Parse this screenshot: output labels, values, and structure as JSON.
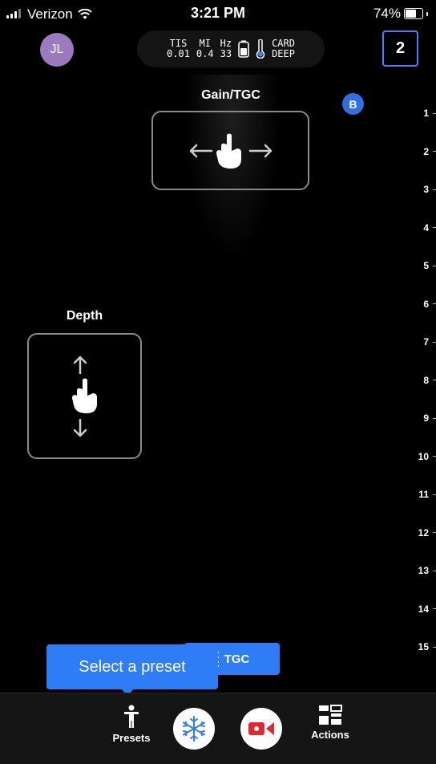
{
  "status_bar": {
    "carrier": "Verizon",
    "time": "3:21 PM",
    "battery": "74%",
    "battery_level": 0.74
  },
  "header": {
    "avatar_initials": "JL",
    "params": [
      {
        "label": "TIS",
        "value": "0.01"
      },
      {
        "label": "MI",
        "value": "0.4"
      },
      {
        "label": "Hz",
        "value": "33"
      }
    ],
    "preset_line1": "CARD",
    "preset_line2": "DEEP",
    "probe_count": "2"
  },
  "image": {
    "mode_badge": "B",
    "gain_label": "Gain/TGC",
    "depth_label": "Depth",
    "depth_ticks": [
      "1",
      "2",
      "3",
      "4",
      "5",
      "6",
      "7",
      "8",
      "9",
      "10",
      "11",
      "12",
      "13",
      "14",
      "15"
    ]
  },
  "tooltip": {
    "text": "Select a preset",
    "tgc_label": "TGC"
  },
  "bottom_bar": {
    "presets_label": "Presets",
    "actions_label": "Actions"
  },
  "colors": {
    "accent": "#2f7df6",
    "record": "#e0282e",
    "avatar": "#9b7ac0"
  },
  "icons": [
    "wifi-icon",
    "signal-icon",
    "battery-icon",
    "thermometer-icon",
    "hand-icon",
    "person-icon",
    "snowflake-icon",
    "video-icon",
    "grid-icon"
  ]
}
